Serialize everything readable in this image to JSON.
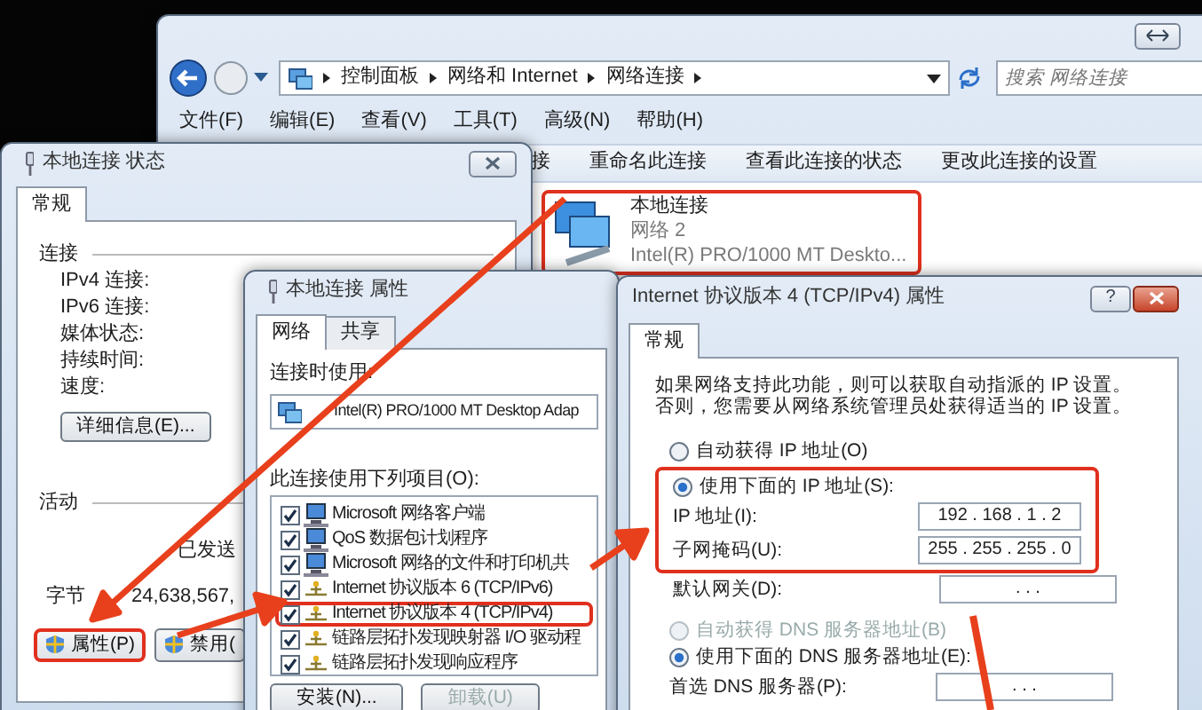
{
  "explorer": {
    "breadcrumb": [
      "控制面板",
      "网络和 Internet",
      "网络连接"
    ],
    "search": {
      "placeholder": "搜索 网络连接"
    },
    "menu": [
      "文件(F)",
      "编辑(E)",
      "查看(V)",
      "工具(T)",
      "高级(N)",
      "帮助(H)"
    ],
    "toolbar": [
      "接",
      "重命名此连接",
      "查看此连接的状态",
      "更改此连接的设置"
    ],
    "connection": {
      "name": "本地连接",
      "network": "网络 2",
      "adapter": "Intel(R) PRO/1000 MT Deskto...",
      "highlighted": true
    }
  },
  "status_dialog": {
    "title": "本地连接 状态",
    "tabs": [
      {
        "label": "常规",
        "selected": true
      }
    ],
    "connection_group": "连接",
    "connection_fields": [
      "IPv4 连接:",
      "IPv6 连接:",
      "媒体状态:",
      "持续时间:",
      "速度:"
    ],
    "details_button": "详细信息(E)...",
    "activity_group": "活动",
    "sent_label": "已发送",
    "bytes_label": "字节",
    "bytes_sent": "24,638,567,",
    "buttons": [
      {
        "label": "属性(P)",
        "highlighted": true
      },
      {
        "label": "禁用(",
        "highlighted": false
      }
    ]
  },
  "properties_dialog": {
    "title": "本地连接 属性",
    "tabs": [
      {
        "label": "网络",
        "selected": true
      },
      {
        "label": "共享",
        "selected": false
      }
    ],
    "connect_using_label": "连接时使用:",
    "adapter": "Intel(R) PRO/1000 MT Desktop Adap",
    "items_label": "此连接使用下列项目(O):",
    "items": [
      {
        "label": "Microsoft 网络客户端",
        "checked": true,
        "kind": "service",
        "highlighted": false
      },
      {
        "label": "QoS 数据包计划程序",
        "checked": true,
        "kind": "service",
        "highlighted": false
      },
      {
        "label": "Microsoft 网络的文件和打印机共",
        "checked": true,
        "kind": "service",
        "highlighted": false
      },
      {
        "label": "Internet 协议版本 6 (TCP/IPv6)",
        "checked": true,
        "kind": "protocol",
        "highlighted": false
      },
      {
        "label": "Internet 协议版本 4 (TCP/IPv4)",
        "checked": true,
        "kind": "protocol",
        "highlighted": true
      },
      {
        "label": "链路层拓扑发现映射器 I/O 驱动程",
        "checked": true,
        "kind": "protocol",
        "highlighted": false
      },
      {
        "label": "链路层拓扑发现响应程序",
        "checked": true,
        "kind": "protocol",
        "highlighted": false
      }
    ],
    "buttons": [
      {
        "label": "安装(N)...",
        "disabled": false
      },
      {
        "label": "卸载(U)",
        "disabled": true
      }
    ]
  },
  "ipv4_dialog": {
    "title": "Internet 协议版本 4 (TCP/IPv4) 属性",
    "help_button": "?",
    "tabs": [
      {
        "label": "常规",
        "selected": true
      }
    ],
    "intro": "如果网络支持此功能，则可以获取自动指派的 IP 设置。否则，您需要从网络系统管理员处获得适当的 IP 设置。",
    "ip_options": [
      {
        "label": "自动获得 IP 地址(O)",
        "selected": false,
        "disabled": false
      },
      {
        "label": "使用下面的 IP 地址(S):",
        "selected": true,
        "disabled": false
      }
    ],
    "ip_highlighted": true,
    "ip_fields": [
      {
        "label": "IP 地址(I):",
        "value": "192 . 168 . 1 . 2"
      },
      {
        "label": "子网掩码(U):",
        "value": "255 . 255 . 255 . 0"
      }
    ],
    "gateway": {
      "label": "默认网关(D):",
      "value": ".  .  ."
    },
    "dns_options": [
      {
        "label": "自动获得 DNS 服务器地址(B)",
        "selected": false,
        "disabled": true
      },
      {
        "label": "使用下面的 DNS 服务器地址(E):",
        "selected": true,
        "disabled": false
      }
    ],
    "dns_fields": [
      {
        "label": "首选 DNS 服务器(P):",
        "value": ".  .  ."
      }
    ]
  }
}
